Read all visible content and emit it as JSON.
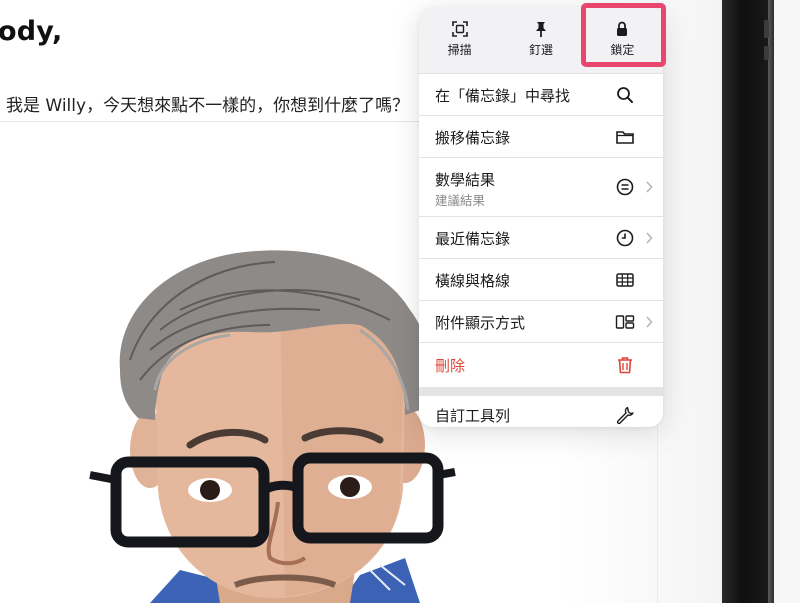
{
  "note": {
    "title": "ody,",
    "line": "我是 Willy，今天想來點不一樣的，你想到什麼了嗎？"
  },
  "menu": {
    "toolbar": [
      {
        "label": "掃描",
        "icon": "scan-icon"
      },
      {
        "label": "釘選",
        "icon": "pin-icon"
      },
      {
        "label": "鎖定",
        "icon": "lock-icon"
      }
    ],
    "items": [
      {
        "label": "在「備忘錄」中尋找",
        "icon": "search-icon"
      },
      {
        "label": "搬移備忘錄",
        "icon": "folder-icon"
      },
      {
        "label": "數學結果",
        "sublabel": "建議結果",
        "icon": "equals-circle-icon"
      },
      {
        "label": "最近備忘錄",
        "icon": "clock-icon"
      },
      {
        "label": "橫線與格線",
        "icon": "grid-icon"
      },
      {
        "label": "附件顯示方式",
        "icon": "attachment-view-icon"
      },
      {
        "label": "刪除",
        "icon": "trash-icon"
      },
      {
        "label": "自訂工具列",
        "icon": "wrench-icon"
      }
    ]
  },
  "colors": {
    "highlight": "#e8466e",
    "danger": "#e0453a",
    "menu_bg": "#f2f2f4"
  }
}
